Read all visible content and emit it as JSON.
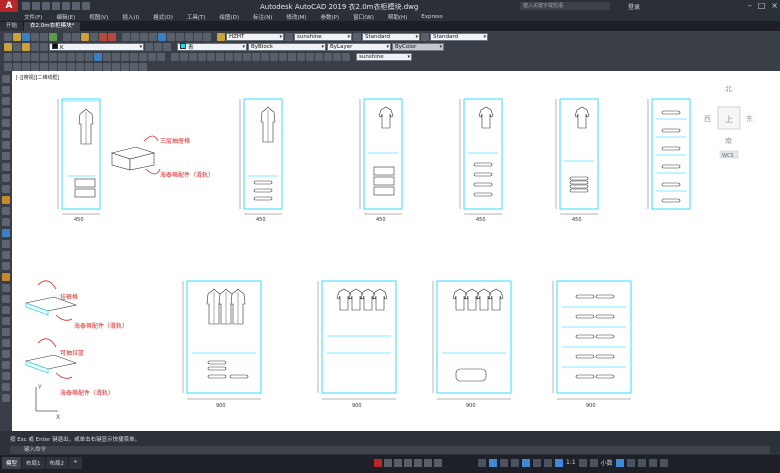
{
  "app": {
    "title": "Autodesk AutoCAD 2019    衣2.0m衣柜模块.dwg",
    "search_placeholder": "键入关键字或短语",
    "login_label": "登录"
  },
  "menu": [
    "文件(F)",
    "编辑(E)",
    "视图(V)",
    "插入(I)",
    "格式(O)",
    "工具(T)",
    "绘图(D)",
    "标注(N)",
    "修改(M)",
    "参数(P)",
    "窗口(W)",
    "帮助(H)",
    "Express"
  ],
  "tabs": [
    {
      "label": "开始"
    },
    {
      "label": "衣2.0m衣柜模块*"
    }
  ],
  "toolbar": {
    "textstyle": "HZHT",
    "dimstyle": "sunshine",
    "tablestyle": "Standard",
    "multileader": "Standard",
    "layer": "K",
    "color": "青",
    "linetype": "ByBlock",
    "lineweight": "ByLayer",
    "plotstyle": "ByColor",
    "dimstyle2": "sunshine"
  },
  "viewport_label": "[-][俯视][二维线框]",
  "viewcube": {
    "north": "北",
    "south": "南",
    "east": "东",
    "west": "西",
    "center": "上",
    "wcs": "WCS"
  },
  "annotations": {
    "drawer": "三层抽屉格",
    "slide_rail": "海泰蒂配件（滑轨）",
    "hanging_shelf": "挂裤格",
    "pull_basket": "可抽拉篮",
    "dims": [
      "450",
      "600",
      "900",
      "2000",
      "1100",
      "400",
      "300",
      "1900",
      "700"
    ]
  },
  "command": {
    "history": "按 Esc 或 Enter 键退出，或单击右键显示快捷菜单。",
    "prompt": "键入命令"
  },
  "layouts": [
    "模型",
    "布局1",
    "布局2"
  ],
  "status": {
    "scale": "1:1",
    "zoom": "小数"
  }
}
